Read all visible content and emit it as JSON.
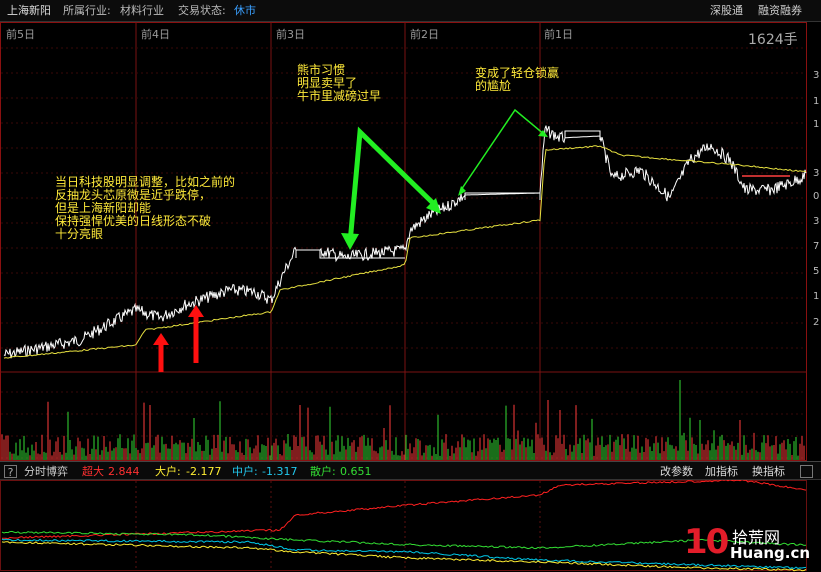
{
  "header": {
    "stock_name": "上海新阳",
    "industry_label": "所属行业:",
    "industry_value": "材料行业",
    "status_label": "交易状态:",
    "status_value": "休市",
    "btn_sgt": "深股通",
    "btn_margin": "融资融券"
  },
  "day_labels": [
    "前5日",
    "前4日",
    "前3日",
    "前2日",
    "前1日"
  ],
  "volume_max": "1624手",
  "axis_right": [
    "3",
    "1",
    "1",
    "3",
    "0",
    "3",
    "7",
    "5",
    "1",
    "2"
  ],
  "annotations": {
    "left": [
      "当日科技股明显调整，比如之前的",
      "反抽龙头芯原微是近乎跌停，",
      "但是上海新阳却能",
      "保持强悍优美的日线形态不破",
      "十分亮眼"
    ],
    "middle": [
      "熊市习惯",
      "明显卖早了",
      "牛市里减磅过早"
    ],
    "right": [
      "变成了轻仓锁赢",
      "的尴尬"
    ]
  },
  "indicator_bar": {
    "help": "?",
    "name": "分时博弈",
    "super_label": "超大",
    "super_value": "2.844",
    "big_label": "大户:",
    "big_value": "-2.177",
    "mid_label": "中户:",
    "mid_value": "-1.317",
    "small_label": "散户:",
    "small_value": "0.651",
    "btn_param": "改参数",
    "btn_add": "加指标",
    "btn_switch": "换指标"
  },
  "logo": {
    "number": "10",
    "cn": "拾荒网",
    "en": "Huang.cn"
  },
  "colors": {
    "price": "#ffffff",
    "avg": "#e6e040",
    "up": "#ff3b3b",
    "down": "#33dd33",
    "super": "#ff2020",
    "big": "#ffee33",
    "mid": "#00c8e8",
    "small": "#33dd33",
    "annotation": "#ffea3a",
    "arrow_red": "#ff1010",
    "arrow_green": "#22ee22"
  }
}
